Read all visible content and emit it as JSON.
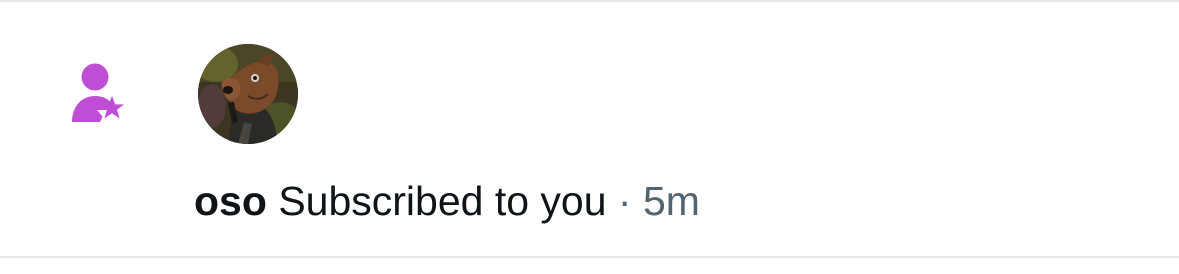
{
  "notification": {
    "icon": "person-star-icon",
    "icon_color": "#c04dd6",
    "avatar": "horse-mask-avatar",
    "username": "oso",
    "action": "Subscribed to you",
    "separator": "·",
    "time": "5m"
  },
  "colors": {
    "text_primary": "#0f1419",
    "text_secondary": "#536471",
    "divider": "#e6e9ec"
  }
}
